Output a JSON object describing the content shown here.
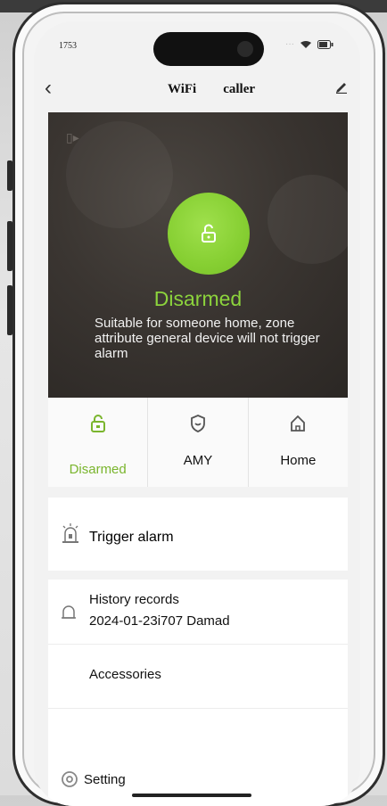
{
  "status_bar": {
    "time": "1753"
  },
  "nav": {
    "title_left": "WiFi",
    "title_right": "caller"
  },
  "hero": {
    "status": "Disarmed",
    "description": "Suitable for someone home, zone attribute general device will not trigger alarm",
    "accent": "#8cd33c"
  },
  "modes": [
    {
      "label": "Disarmed",
      "icon": "unlock-icon",
      "active": true
    },
    {
      "label": "AMY",
      "icon": "shield-icon",
      "active": false
    },
    {
      "label": "Home",
      "icon": "home-icon",
      "active": false
    }
  ],
  "menu": {
    "trigger_alarm": {
      "label": "Trigger alarm",
      "icon": "alarm-icon"
    },
    "history": {
      "label": "History records",
      "subtitle": "2024-01-23i707 Damad",
      "icon": "bell-icon"
    },
    "accessories": {
      "label": "Accessories"
    },
    "setting": {
      "label": "Setting",
      "icon": "gear-icon"
    }
  }
}
